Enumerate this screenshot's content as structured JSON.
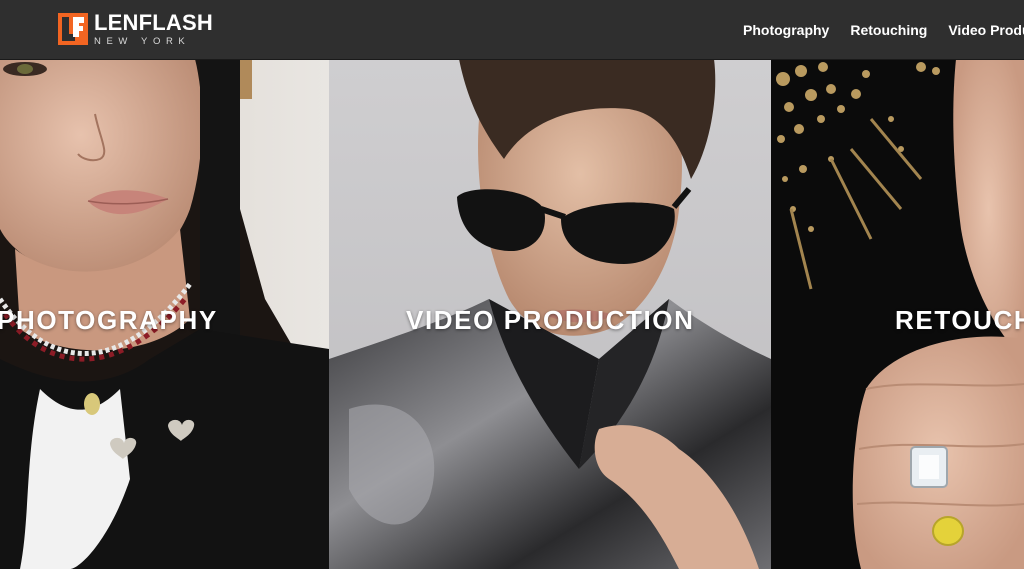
{
  "brand": {
    "name": "LENFLASH",
    "tagline": "NEW YORK",
    "accent_color": "#f26522"
  },
  "nav": {
    "items": [
      {
        "label": "Photography"
      },
      {
        "label": "Retouching"
      },
      {
        "label": "Video Production"
      }
    ]
  },
  "panels": [
    {
      "title": "PHOTOGRAPHY",
      "image": "woman-with-ruby-diamond-necklace"
    },
    {
      "title": "VIDEO PRODUCTION",
      "image": "man-in-dark-sunglasses"
    },
    {
      "title": "RETOUCHING",
      "image": "hand-with-diamond-rings"
    }
  ]
}
